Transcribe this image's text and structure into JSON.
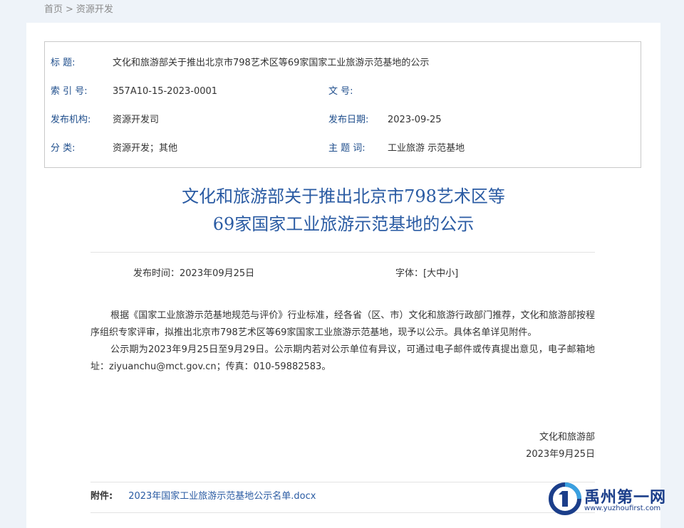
{
  "breadcrumb": {
    "home": "首页",
    "separator": ">",
    "current": "资源开发"
  },
  "meta": {
    "title_label": "标 题:",
    "title_value": "文化和旅游部关于推出北京市798艺术区等69家国家工业旅游示范基地的公示",
    "index_label": "索 引 号:",
    "index_value": "357A10-15-2023-0001",
    "docno_label": "文 号:",
    "docno_value": "",
    "org_label": "发布机构:",
    "org_value": "资源开发司",
    "date_label": "发布日期:",
    "date_value": "2023-09-25",
    "category_label": "分 类:",
    "category_value": "资源开发；其他",
    "keywords_label": "主 题 词:",
    "keywords_value": "工业旅游 示范基地"
  },
  "article": {
    "title_line1": "文化和旅游部关于推出北京市798艺术区等",
    "title_line2": "69家国家工业旅游示范基地的公示",
    "publish_time": "发布时间：2023年09月25日",
    "font_label": "字体：",
    "font_open": "[",
    "font_large": "大",
    "font_medium": "中",
    "font_small": "小",
    "font_close": "]",
    "paragraph1": "根据《国家工业旅游示范基地规范与评价》行业标准，经各省（区、市）文化和旅游行政部门推荐，文化和旅游部按程序组织专家评审，拟推出北京市798艺术区等69家国家工业旅游示范基地，现予以公示。具体名单详见附件。",
    "paragraph2": "公示期为2023年9月25日至9月29日。公示期内若对公示单位有异议，可通过电子邮件或传真提出意见，电子邮箱地址：ziyuanchu@mct.gov.cn；传真：010-59882583。",
    "signature_org": "文化和旅游部",
    "signature_date": "2023年9月25日",
    "attachment_label": "附件:",
    "attachment_link": "2023年国家工业旅游示范基地公示名单.docx"
  },
  "watermark": {
    "name": "禹州第一网",
    "url": "www.yuzhoufirst.com"
  },
  "colors": {
    "heading_blue": "#2a5ba3",
    "label_blue": "#1f4e8c",
    "page_bg": "#eef3f9"
  }
}
